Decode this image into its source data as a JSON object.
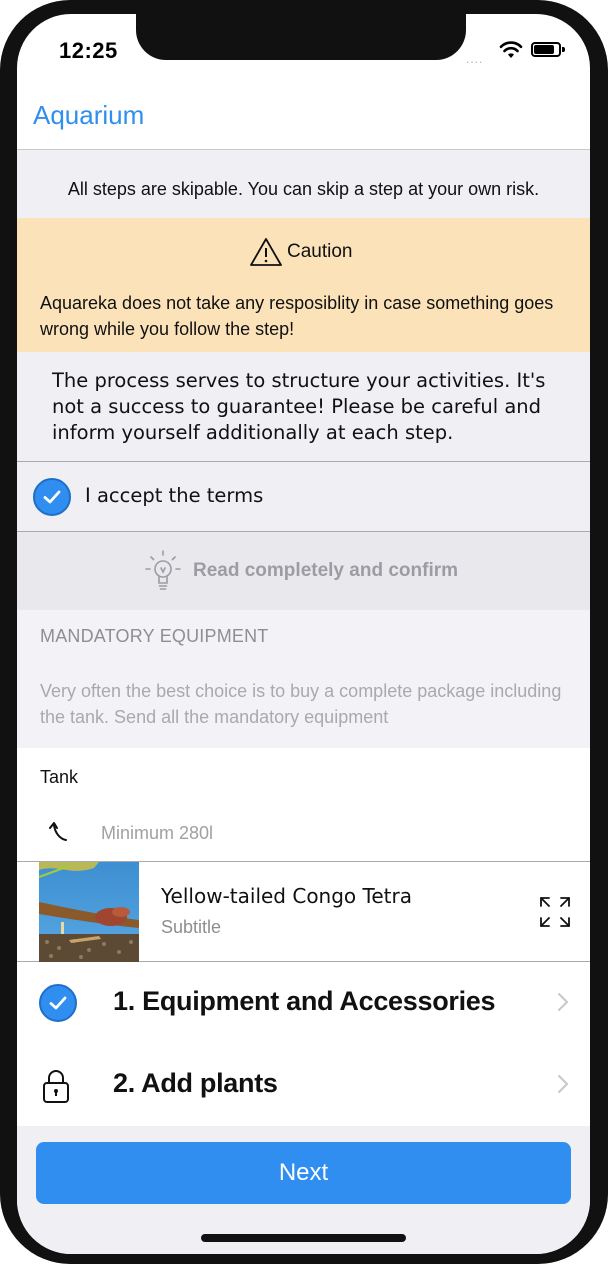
{
  "status": {
    "time": "12:25",
    "signal": "...."
  },
  "nav": {
    "title": "Aquarium"
  },
  "skip_notice": "All steps are skipable. You can skip a step at your own risk.",
  "caution": {
    "title": "Caution",
    "body": "Aquareka does not take any resposiblity in case something goes wrong while you follow the step!"
  },
  "process_text": "The process serves to structure your activities. It's not a success to guarantee! Please be careful and inform yourself additionally at each step.",
  "accept": {
    "label": "I accept the terms",
    "checked": true
  },
  "read_confirm": {
    "label": "Read completely and confirm"
  },
  "mandatory": {
    "heading": "MANDATORY EQUIPMENT",
    "text": "Very often the best choice is to buy a complete package including the tank. Send all the mandatory equipment"
  },
  "tank": {
    "label": "Tank",
    "requirement": "Minimum 280l"
  },
  "fish": {
    "name": "Yellow-tailed Congo Tetra",
    "subtitle": "Subtitle"
  },
  "steps": [
    {
      "label": "1. Equipment and Accessories",
      "state": "completed"
    },
    {
      "label": "2. Add plants",
      "state": "locked"
    }
  ],
  "next_button": {
    "label": "Next"
  },
  "colors": {
    "accent": "#2f8ef0",
    "caution_bg": "#fbe2b9",
    "grouped_bg": "#efeff4"
  }
}
